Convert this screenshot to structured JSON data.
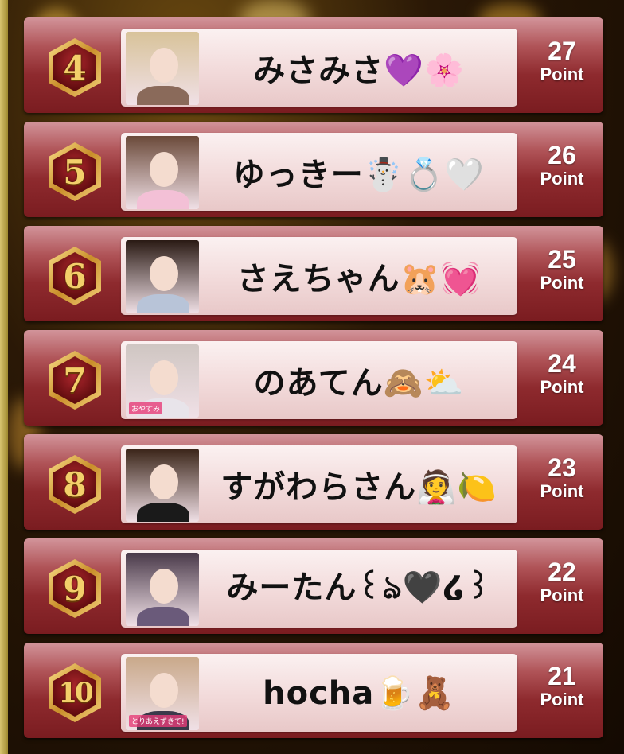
{
  "ranking": [
    {
      "rank": "4",
      "name": "みさみさ💜🌸",
      "points": "27",
      "point_unit": "Point",
      "avatar": {
        "hair": "#d8c39a",
        "body": "#8a6a5a",
        "caption": ""
      }
    },
    {
      "rank": "5",
      "name": "ゆっきー☃️💍🤍",
      "points": "26",
      "point_unit": "Point",
      "avatar": {
        "hair": "#6b4a3a",
        "body": "#f3c0d6",
        "caption": ""
      }
    },
    {
      "rank": "6",
      "name": "さえちゃん🐹💓",
      "points": "25",
      "point_unit": "Point",
      "avatar": {
        "hair": "#2a1a14",
        "body": "#b8c4d8",
        "caption": ""
      }
    },
    {
      "rank": "7",
      "name": "のあてん🙈⛅",
      "points": "24",
      "point_unit": "Point",
      "avatar": {
        "hair": "#cfc6c2",
        "body": "#e8e4ea",
        "caption": "おやすみ"
      }
    },
    {
      "rank": "8",
      "name": "すがわらさん👰🍋",
      "points": "23",
      "point_unit": "Point",
      "avatar": {
        "hair": "#3a2418",
        "body": "#1a1a1a",
        "caption": ""
      }
    },
    {
      "rank": "9",
      "name": "みーたん꒰ঌ🖤໒꒱",
      "points": "22",
      "point_unit": "Point",
      "avatar": {
        "hair": "#4a3a4a",
        "body": "#6a5a7a",
        "caption": ""
      }
    },
    {
      "rank": "10",
      "name": "hocha🍺🧸",
      "points": "21",
      "point_unit": "Point",
      "avatar": {
        "hair": "#c9a98a",
        "body": "#3a3a4a",
        "caption": "とりあえずきて!"
      }
    }
  ],
  "colors": {
    "badge_gold": "#e8c060",
    "badge_red": "#8a1418",
    "row_red": "#8e2a2e"
  }
}
